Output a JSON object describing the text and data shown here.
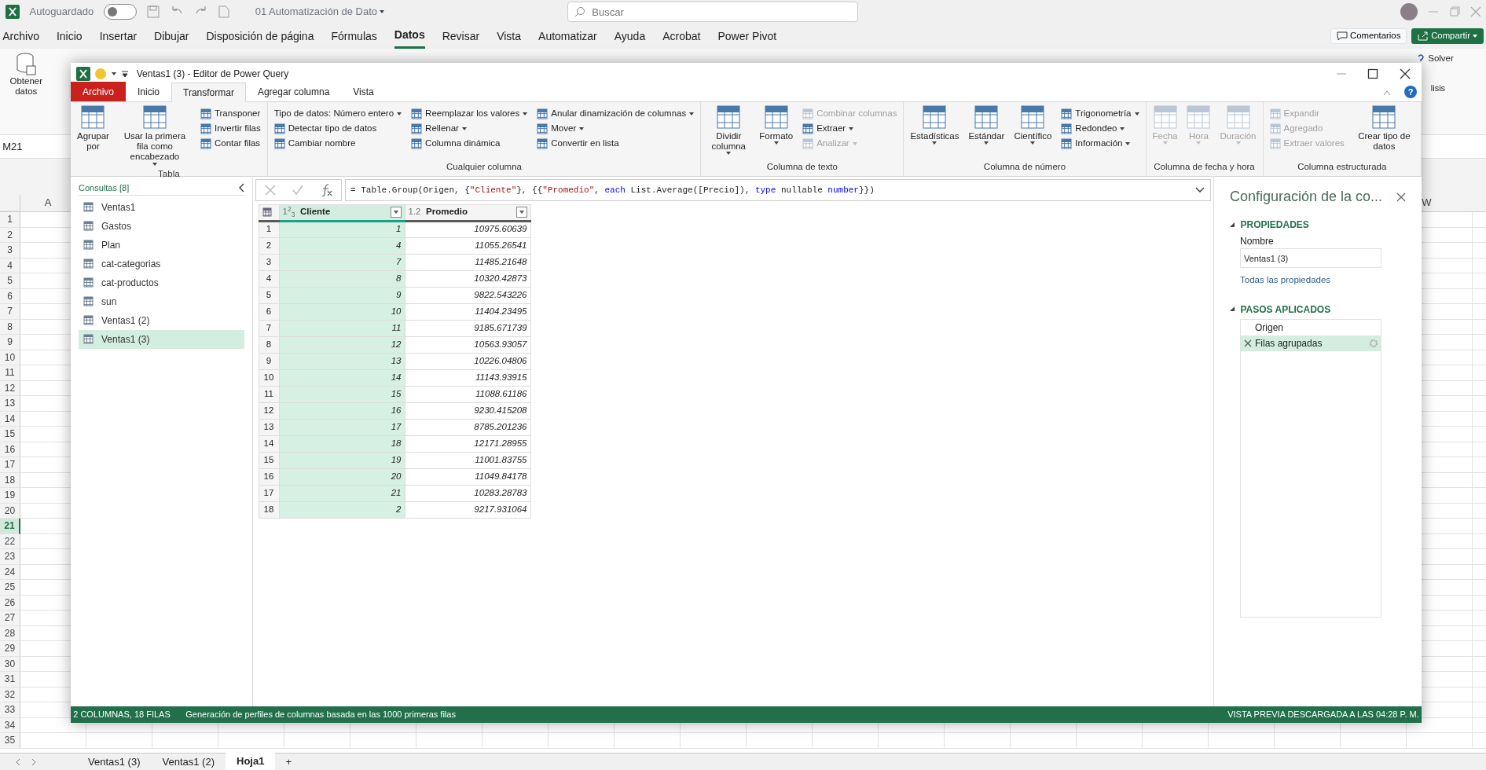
{
  "excel": {
    "autosave": {
      "label": "Autoguardado",
      "on": false
    },
    "file_title": "01 Automatización de Dato",
    "search": {
      "placeholder": "Buscar"
    },
    "menu": [
      {
        "label": "Archivo",
        "selected": false
      },
      {
        "label": "Inicio",
        "selected": false
      },
      {
        "label": "Insertar",
        "selected": false
      },
      {
        "label": "Dibujar",
        "selected": false
      },
      {
        "label": "Disposición de página",
        "selected": false
      },
      {
        "label": "Fórmulas",
        "selected": false
      },
      {
        "label": "Datos",
        "selected": true
      },
      {
        "label": "Revisar",
        "selected": false
      },
      {
        "label": "Vista",
        "selected": false
      },
      {
        "label": "Automatizar",
        "selected": false
      },
      {
        "label": "Ayuda",
        "selected": false
      },
      {
        "label": "Acrobat",
        "selected": false
      },
      {
        "label": "Power Pivot",
        "selected": false
      }
    ],
    "comments": "Comentarios",
    "share": "Compartir",
    "ribbon": {
      "get_data": "Obtener datos",
      "solver": "Solver",
      "analysis": "lisis"
    },
    "name_box": "M21",
    "columns": [
      "A",
      "W"
    ],
    "rows": [
      {
        "label": "1",
        "selected": false
      },
      {
        "label": "2",
        "selected": false
      },
      {
        "label": "3",
        "selected": false
      },
      {
        "label": "4",
        "selected": false
      },
      {
        "label": "5",
        "selected": false
      },
      {
        "label": "6",
        "selected": false
      },
      {
        "label": "7",
        "selected": false
      },
      {
        "label": "8",
        "selected": false
      },
      {
        "label": "9",
        "selected": false
      },
      {
        "label": "10",
        "selected": false
      },
      {
        "label": "11",
        "selected": false
      },
      {
        "label": "12",
        "selected": false
      },
      {
        "label": "13",
        "selected": false
      },
      {
        "label": "14",
        "selected": false
      },
      {
        "label": "15",
        "selected": false
      },
      {
        "label": "16",
        "selected": false
      },
      {
        "label": "17",
        "selected": false
      },
      {
        "label": "18",
        "selected": false
      },
      {
        "label": "19",
        "selected": false
      },
      {
        "label": "20",
        "selected": false
      },
      {
        "label": "21",
        "selected": true
      },
      {
        "label": "22",
        "selected": false
      },
      {
        "label": "23",
        "selected": false
      },
      {
        "label": "24",
        "selected": false
      },
      {
        "label": "25",
        "selected": false
      },
      {
        "label": "26",
        "selected": false
      },
      {
        "label": "27",
        "selected": false
      },
      {
        "label": "28",
        "selected": false
      },
      {
        "label": "29",
        "selected": false
      },
      {
        "label": "30",
        "selected": false
      },
      {
        "label": "31",
        "selected": false
      },
      {
        "label": "32",
        "selected": false
      },
      {
        "label": "33",
        "selected": false
      },
      {
        "label": "34",
        "selected": false
      },
      {
        "label": "35",
        "selected": false
      }
    ],
    "sheets": [
      {
        "label": "Ventas1 (3)",
        "selected": false
      },
      {
        "label": "Ventas1 (2)",
        "selected": false
      },
      {
        "label": "Hoja1",
        "selected": true
      }
    ],
    "add_sheet": "+"
  },
  "power_query": {
    "title": "Ventas1 (3) - Editor de Power Query",
    "help": "?",
    "tabs": [
      {
        "label": "Archivo",
        "kind": "file",
        "selected": false
      },
      {
        "label": "Inicio",
        "kind": "tab",
        "selected": false
      },
      {
        "label": "Transformar",
        "kind": "tab",
        "selected": true
      },
      {
        "label": "Agregar columna",
        "kind": "tab",
        "selected": false
      },
      {
        "label": "Vista",
        "kind": "tab",
        "selected": false
      }
    ],
    "ribbon": [
      {
        "label": "Tabla",
        "columns": [
          {
            "kind": "large",
            "label": "Agrupar por",
            "dropdown": false,
            "disabled": false
          },
          {
            "kind": "large",
            "label": "Usar la primera fila como encabezado",
            "dropdown": true,
            "disabled": false
          },
          {
            "kind": "stack",
            "items": [
              {
                "kind": "icon",
                "label": "Transponer",
                "dropdown": false,
                "disabled": false
              },
              {
                "kind": "icon",
                "label": "Invertir filas",
                "dropdown": false,
                "disabled": false
              },
              {
                "kind": "icon",
                "label": "Contar filas",
                "dropdown": false,
                "disabled": false
              }
            ]
          }
        ]
      },
      {
        "label": "Cualquier columna",
        "columns": [
          {
            "kind": "stack",
            "items": [
              {
                "kind": "plain",
                "label": "Tipo de datos: Número entero",
                "dropdown": true,
                "disabled": false
              },
              {
                "kind": "icon",
                "label": "Detectar tipo de datos",
                "dropdown": false,
                "disabled": false
              },
              {
                "kind": "icon",
                "label": "Cambiar nombre",
                "dropdown": false,
                "disabled": false
              }
            ]
          },
          {
            "kind": "stack",
            "items": [
              {
                "kind": "icon",
                "label": "Reemplazar los valores",
                "dropdown": true,
                "disabled": false
              },
              {
                "kind": "icon",
                "label": "Rellenar",
                "dropdown": true,
                "disabled": false
              },
              {
                "kind": "icon",
                "label": "Columna dinámica",
                "dropdown": false,
                "disabled": false
              }
            ]
          },
          {
            "kind": "stack",
            "items": [
              {
                "kind": "icon",
                "label": "Anular dinamización de columnas",
                "dropdown": true,
                "disabled": false
              },
              {
                "kind": "icon",
                "label": "Mover",
                "dropdown": true,
                "disabled": false
              },
              {
                "kind": "icon",
                "label": "Convertir en lista",
                "dropdown": false,
                "disabled": false
              }
            ]
          }
        ]
      },
      {
        "label": "Columna de texto",
        "columns": [
          {
            "kind": "large",
            "label": "Dividir columna",
            "dropdown": true,
            "disabled": false
          },
          {
            "kind": "large",
            "label": "Formato",
            "dropdown": true,
            "disabled": false
          },
          {
            "kind": "stack",
            "items": [
              {
                "kind": "icon",
                "label": "Combinar columnas",
                "dropdown": false,
                "disabled": true
              },
              {
                "kind": "icon",
                "label": "Extraer",
                "dropdown": true,
                "disabled": false
              },
              {
                "kind": "icon",
                "label": "Analizar",
                "dropdown": true,
                "disabled": true
              }
            ]
          }
        ]
      },
      {
        "label": "Columna de número",
        "columns": [
          {
            "kind": "large",
            "label": "Estadísticas",
            "dropdown": true,
            "disabled": false
          },
          {
            "kind": "large",
            "label": "Estándar",
            "dropdown": true,
            "disabled": false
          },
          {
            "kind": "large",
            "label": "Científico",
            "dropdown": true,
            "disabled": false
          },
          {
            "kind": "stack",
            "items": [
              {
                "kind": "icon",
                "label": "Trigonometría",
                "dropdown": true,
                "disabled": false
              },
              {
                "kind": "icon",
                "label": "Redondeo",
                "dropdown": true,
                "disabled": false
              },
              {
                "kind": "icon",
                "label": "Información",
                "dropdown": true,
                "disabled": false
              }
            ]
          }
        ]
      },
      {
        "label": "Columna de fecha y hora",
        "columns": [
          {
            "kind": "large",
            "label": "Fecha",
            "dropdown": true,
            "disabled": true
          },
          {
            "kind": "large",
            "label": "Hora",
            "dropdown": true,
            "disabled": true
          },
          {
            "kind": "large",
            "label": "Duración",
            "dropdown": true,
            "disabled": true
          }
        ]
      },
      {
        "label": "Columna estructurada",
        "columns": [
          {
            "kind": "stack",
            "items": [
              {
                "kind": "icon",
                "label": "Expandir",
                "dropdown": false,
                "disabled": true
              },
              {
                "kind": "icon",
                "label": "Agregado",
                "dropdown": false,
                "disabled": true
              },
              {
                "kind": "icon",
                "label": "Extraer valores",
                "dropdown": false,
                "disabled": true
              }
            ]
          },
          {
            "kind": "large",
            "label": "Crear tipo de datos",
            "dropdown": false,
            "disabled": false
          }
        ]
      }
    ],
    "queries": {
      "heading": "Consultas [8]",
      "items": [
        {
          "label": "Ventas1",
          "selected": false
        },
        {
          "label": "Gastos",
          "selected": false
        },
        {
          "label": "Plan",
          "selected": false
        },
        {
          "label": "cat-categorias",
          "selected": false
        },
        {
          "label": "cat-productos",
          "selected": false
        },
        {
          "label": "sun",
          "selected": false
        },
        {
          "label": "Ventas1 (2)",
          "selected": false
        },
        {
          "label": "Ventas1 (3)",
          "selected": true
        }
      ]
    },
    "formula": [
      {
        "kind": "plain",
        "text": "= Table.Group(Origen, {"
      },
      {
        "kind": "string",
        "text": "\"Cliente\""
      },
      {
        "kind": "plain",
        "text": "}, {{"
      },
      {
        "kind": "string",
        "text": "\"Promedio\""
      },
      {
        "kind": "plain",
        "text": ", "
      },
      {
        "kind": "keyword",
        "text": "each"
      },
      {
        "kind": "plain",
        "text": " List.Average([Precio]), "
      },
      {
        "kind": "keyword",
        "text": "type"
      },
      {
        "kind": "plain",
        "text": " nullable "
      },
      {
        "kind": "keyword",
        "text": "number"
      },
      {
        "kind": "plain",
        "text": "}})"
      }
    ],
    "table": {
      "columns": [
        {
          "type": "1$^{2}$$_{3}$",
          "name": "Cliente",
          "selected": true
        },
        {
          "type": "1.2",
          "name": "Promedio",
          "selected": false
        }
      ],
      "rows": [
        {
          "number": "1",
          "cells": [
            "1",
            "10975.60639"
          ]
        },
        {
          "number": "2",
          "cells": [
            "4",
            "11055.26541"
          ]
        },
        {
          "number": "3",
          "cells": [
            "7",
            "11485.21648"
          ]
        },
        {
          "number": "4",
          "cells": [
            "8",
            "10320.42873"
          ]
        },
        {
          "number": "5",
          "cells": [
            "9",
            "9822.543226"
          ]
        },
        {
          "number": "6",
          "cells": [
            "10",
            "11404.23495"
          ]
        },
        {
          "number": "7",
          "cells": [
            "11",
            "9185.671739"
          ]
        },
        {
          "number": "8",
          "cells": [
            "12",
            "10563.93057"
          ]
        },
        {
          "number": "9",
          "cells": [
            "13",
            "10226.04806"
          ]
        },
        {
          "number": "10",
          "cells": [
            "14",
            "11143.93915"
          ]
        },
        {
          "number": "11",
          "cells": [
            "15",
            "11088.61186"
          ]
        },
        {
          "number": "12",
          "cells": [
            "16",
            "9230.415208"
          ]
        },
        {
          "number": "13",
          "cells": [
            "17",
            "8785.201236"
          ]
        },
        {
          "number": "14",
          "cells": [
            "18",
            "12171.28955"
          ]
        },
        {
          "number": "15",
          "cells": [
            "19",
            "11001.83755"
          ]
        },
        {
          "number": "16",
          "cells": [
            "20",
            "11049.84178"
          ]
        },
        {
          "number": "17",
          "cells": [
            "21",
            "10283.28783"
          ]
        },
        {
          "number": "18",
          "cells": [
            "2",
            "9217.931064"
          ]
        }
      ]
    },
    "settings": {
      "title": "Configuración de la co...",
      "properties": "PROPIEDADES",
      "name_label": "Nombre",
      "name_value": "Ventas1 (3)",
      "all_properties": "Todas las propiedades",
      "steps_heading": "PASOS APLICADOS",
      "steps": [
        {
          "label": "Origen",
          "selected": false
        },
        {
          "label": "Filas agrupadas",
          "selected": true
        }
      ]
    },
    "status": {
      "counts": "2 COLUMNAS, 18 FILAS",
      "profile": "Generación de perfiles de columnas basada en las 1000 primeras filas",
      "preview": "VISTA PREVIA DESCARGADA A LAS 04:28 P. M."
    }
  }
}
